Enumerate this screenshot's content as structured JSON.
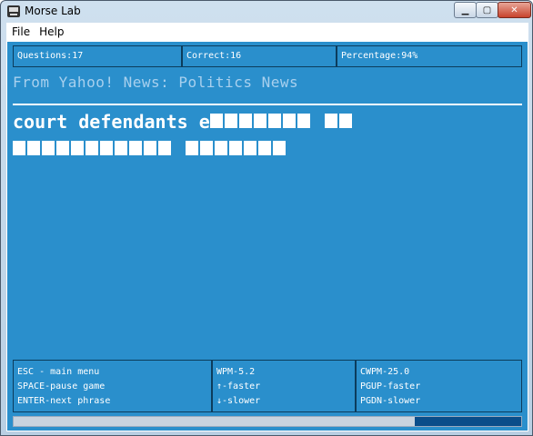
{
  "window": {
    "title": "Morse Lab"
  },
  "menu": {
    "items": [
      "File",
      "Help"
    ]
  },
  "stats": {
    "questions": "Questions:17",
    "correct": "Correct:16",
    "percentage": "Percentage:94%"
  },
  "source": "From Yahoo! News: Politics News",
  "phrase": {
    "line1_text": "court defendants e",
    "line1_blocks": [
      7,
      2
    ],
    "line2_blocks": [
      11,
      7
    ]
  },
  "footer": {
    "col1": [
      "ESC - main menu",
      "SPACE-pause game",
      "ENTER-next phrase"
    ],
    "col2": [
      "WPM-5.2",
      "↑-faster",
      "↓-slower"
    ],
    "col3": [
      "CWPM-25.0",
      "PGUP-faster",
      "PGDN-slower"
    ]
  },
  "progress": {
    "fraction": 0.21
  }
}
